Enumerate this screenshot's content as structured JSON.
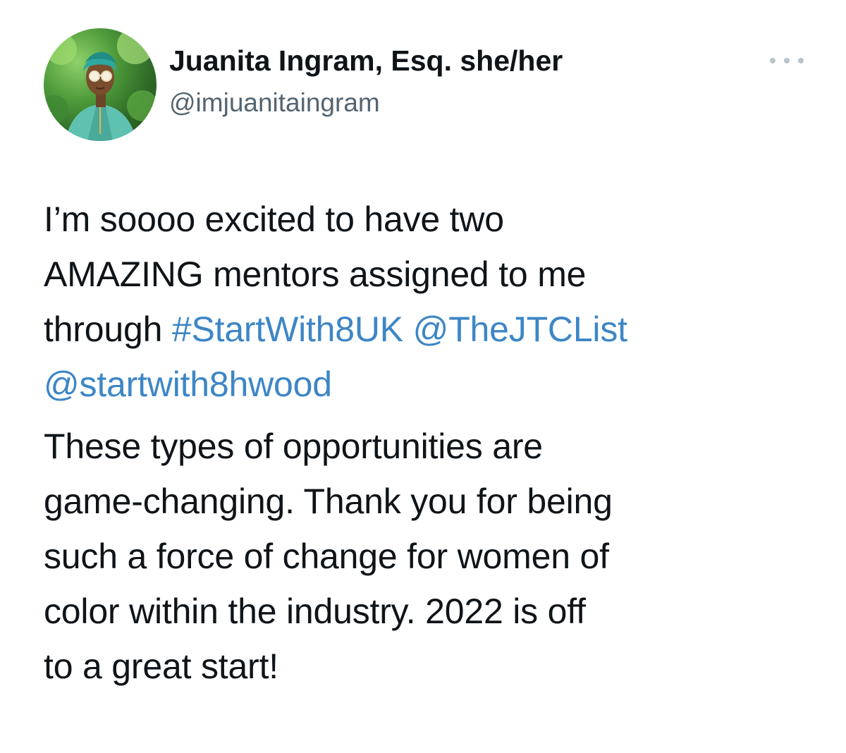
{
  "author": {
    "name": "Juanita Ingram, Esq. she/her",
    "handle": "@imjuanitaingram",
    "avatar_icon": "profile-photo"
  },
  "more_icon": "more-options-icon",
  "tweet": {
    "para1": {
      "line1": "I’m soooo excited to have two",
      "line2": "AMAZING mentors assigned to me",
      "line3_prefix": "through ",
      "hashtag": "#StartWith8UK",
      "mention1": "@TheJTCList",
      "mention2": "@startwith8hwood"
    },
    "para2": {
      "line1": "These types of opportunities are",
      "line2": "game-changing. Thank you for being",
      "line3": "such a force of change for women of",
      "line4": "color within the industry. 2022 is off",
      "line5": "to a great start!"
    }
  },
  "colors": {
    "link": "#3d86c6",
    "handle": "#536471",
    "text": "#0f1419"
  }
}
